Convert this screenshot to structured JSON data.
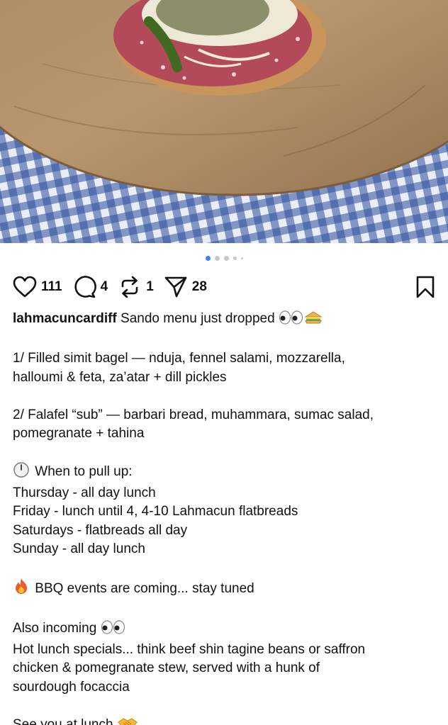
{
  "post": {
    "carousel": {
      "count": 5,
      "active_index": 0
    }
  },
  "actions": {
    "likes": "111",
    "comments": "4",
    "reposts": "1",
    "shares": "28"
  },
  "caption": {
    "username": "lahmacuncardiff",
    "headline": "Sando menu just dropped",
    "item1_line1": "1/ Filled simit bagel — nduja, fennel salami, mozzarella,",
    "item1_line2": "halloumi & feta, za’atar + dill pickles",
    "item2_line1": "2/ Falafel “sub” — barbari bread, muhammara, sumac salad,",
    "item2_line2": "pomegranate + tahina",
    "hours_title": "When to pull up:",
    "hours": [
      "Thursday - all day lunch",
      "Friday - lunch until 4, 4-10 Lahmacun flatbreads",
      "Saturdays - flatbreads all day",
      "Sunday - all day lunch"
    ],
    "bbq": "BBQ events are coming... stay tuned",
    "also_incoming": "Also incoming",
    "specials": [
      "Hot lunch specials... think beef shin tagine beans or saffron",
      "chicken & pomegranate stew, served with a hunk of",
      "sourdough focaccia"
    ],
    "signoff": "See you at lunch"
  },
  "icons": {
    "like": "heart-icon",
    "comment": "comment-bubble-icon",
    "repost": "repost-arrows-icon",
    "share": "paper-plane-icon",
    "save": "bookmark-icon",
    "eyes": "eyes-emoji-icon",
    "sandwich": "sandwich-emoji-icon",
    "clock": "clock-emoji-icon",
    "fire": "fire-emoji-icon",
    "handshake": "handshake-emoji-icon"
  }
}
